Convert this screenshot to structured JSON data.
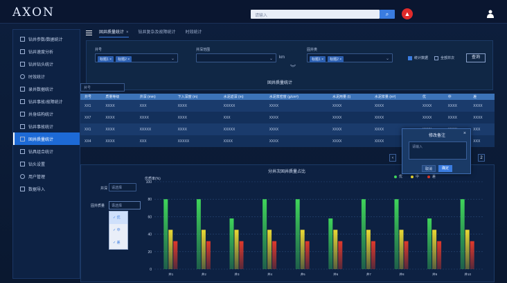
{
  "header": {
    "logo": "AXON",
    "search_placeholder": "请输入"
  },
  "sidebar": {
    "items": [
      {
        "label": "钻井参数/数据统计"
      },
      {
        "label": "钻井速度分析"
      },
      {
        "label": "钻井钻头统计"
      },
      {
        "label": "时效统计"
      },
      {
        "label": "录井数据统计"
      },
      {
        "label": "钻井事故/故障统计"
      },
      {
        "label": "井身结构统计"
      },
      {
        "label": "钻井事故统计"
      },
      {
        "label": "固井质量统计"
      },
      {
        "label": "钻具组合统计"
      },
      {
        "label": "钻头设置"
      },
      {
        "label": "用户管理"
      },
      {
        "label": "数据导入"
      }
    ],
    "active_index": 8
  },
  "tabs": [
    {
      "label": "固井质量统计",
      "closable": "×"
    },
    {
      "label": "钻井复杂及故障统计"
    },
    {
      "label": "时效统计"
    }
  ],
  "filter": {
    "field1_label": "井号",
    "field1_chips": [
      "标题1 ×",
      "标题2 ×"
    ],
    "field2_label": "井深范围",
    "field2_unit": "km",
    "field3_label": "固井类",
    "field3_chips": [
      "标题1 ×",
      "标题2 ×"
    ],
    "check1": "统计数据",
    "check2": "全部井次",
    "query_button": "查询"
  },
  "table": {
    "title": "固井质量统计",
    "select_placeholder": "井号",
    "headers": [
      "井号",
      "质量等级",
      "井深 (mm)",
      "下入深度 (m)",
      "水泥返深 (m)",
      "水泥浆密度 (g/cm³)",
      "水泥用量 (t)",
      "水泥浆量 (m³)",
      "固井质量"
    ],
    "sub_headers": [
      "优",
      "中",
      "差"
    ],
    "rows": [
      [
        "XX1",
        "XXXX",
        "XXX",
        "XXXX",
        "XXXXX",
        "XXXX",
        "XXXX",
        "XXXX",
        "XXXX",
        "XXXX",
        "XXXX"
      ],
      [
        "XX7",
        "XXXX",
        "XXXX",
        "XXXX",
        "XXX",
        "XXXX",
        "XXXX",
        "XXXX",
        "XXXX",
        "XXXX",
        "XXXX"
      ],
      [
        "XX1",
        "XXXX",
        "XXXXX",
        "XXXX",
        "XXXXX",
        "XXXX",
        "XXXX",
        "XXXX",
        "XXXX",
        "XXXX",
        "XXX"
      ],
      [
        "XX4",
        "XXXX",
        "XXX",
        "XXXXX",
        "XXXX",
        "XXXX",
        "XXXX",
        "XXXX",
        "XXXX",
        "XXXX",
        "XXX"
      ]
    ]
  },
  "pager": {
    "page": "2"
  },
  "modal": {
    "title": "修改备注",
    "placeholder": "请输入",
    "cancel": "取消",
    "confirm": "确定"
  },
  "chart_panel": {
    "field1_label": "井深",
    "field1_value": "请选择",
    "field2_label": "固井质量",
    "field2_value": "请选择",
    "dropdown_options": [
      "优",
      "中",
      "差"
    ]
  },
  "chart_data": {
    "type": "bar",
    "title": "分井次固井质量占比",
    "ylabel": "优质率(%)",
    "ylim": [
      0,
      100
    ],
    "yticks": [
      "0",
      "20",
      "40",
      "60",
      "80",
      "100"
    ],
    "categories": [
      "井1",
      "井2",
      "井3",
      "井4",
      "井5",
      "井6",
      "井7",
      "井8",
      "井9",
      "井10"
    ],
    "series": [
      {
        "name": "优",
        "color": "#3fd45a",
        "values": [
          80,
          80,
          58,
          80,
          80,
          58,
          80,
          80,
          58,
          80
        ]
      },
      {
        "name": "中",
        "color": "#e9d833",
        "values": [
          45,
          45,
          45,
          45,
          45,
          45,
          45,
          45,
          45,
          45
        ]
      },
      {
        "name": "差",
        "color": "#e0392b",
        "values": [
          32,
          32,
          32,
          32,
          32,
          32,
          32,
          32,
          32,
          32
        ]
      }
    ]
  }
}
